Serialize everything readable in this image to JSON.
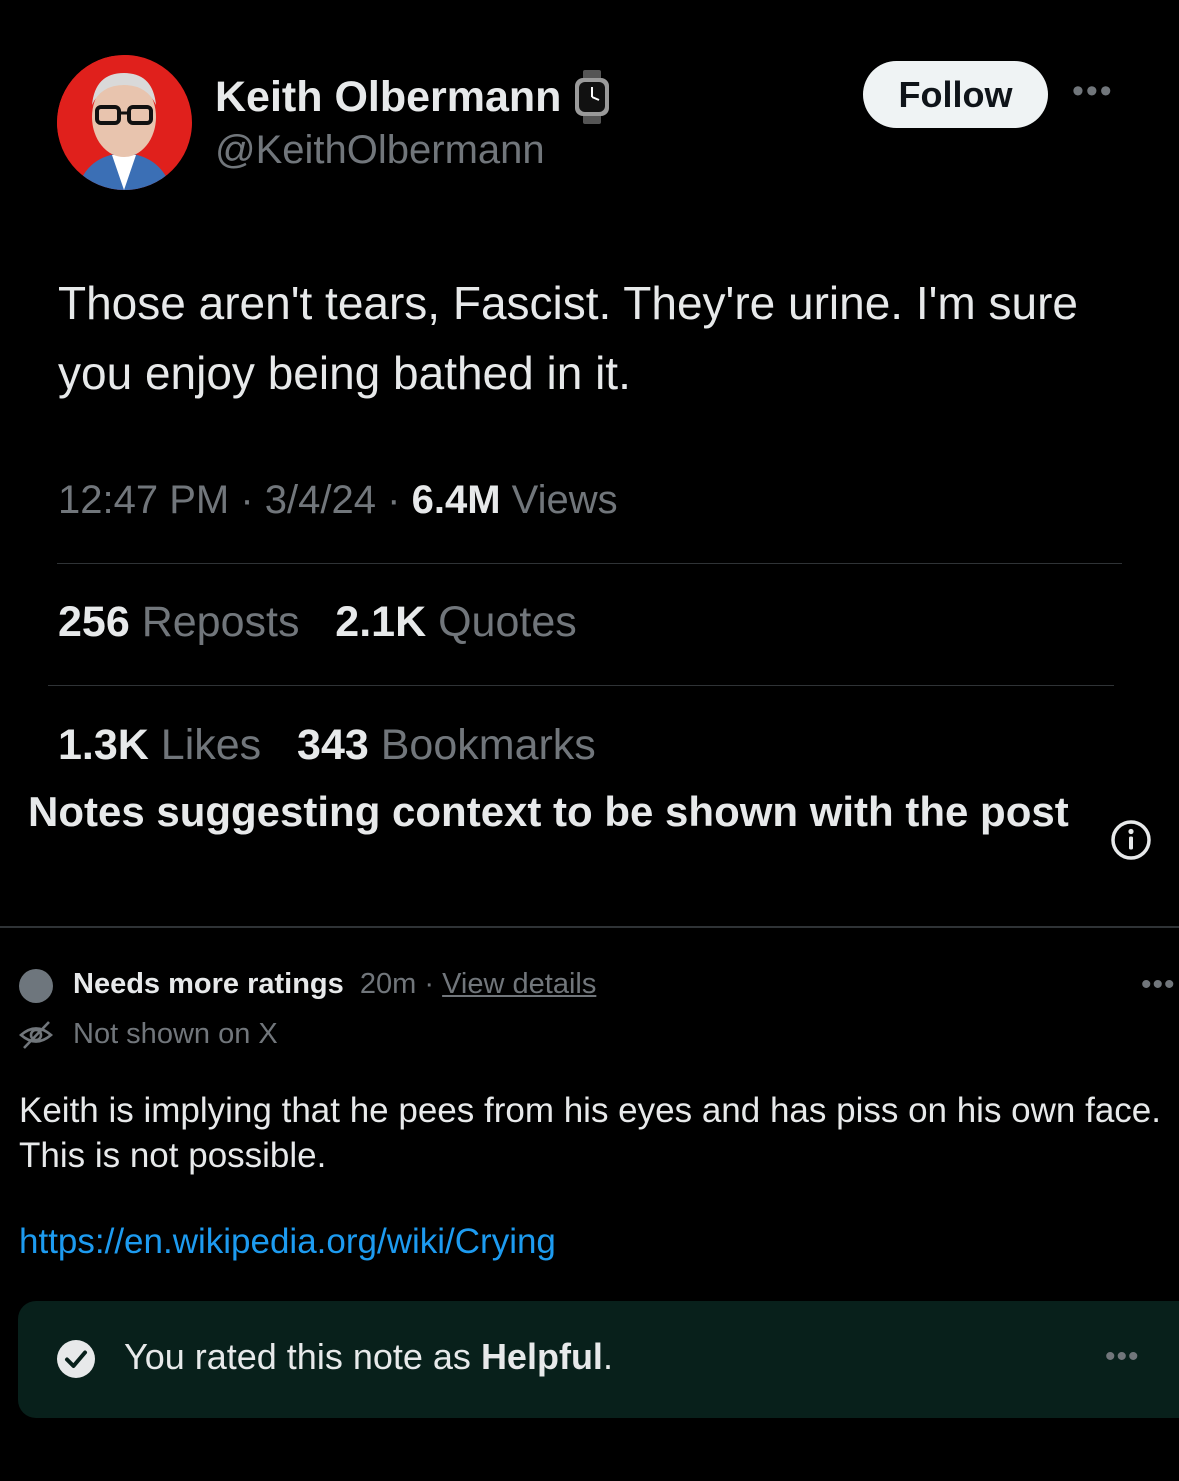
{
  "author": {
    "name": "Keith Olbermann",
    "handle": "@KeithOlbermann",
    "badge_icon": "watch-icon"
  },
  "follow_label": "Follow",
  "more_icon": "more-horizontal-icon",
  "tweet": {
    "text": "Those aren't tears, Fascist. They're urine. I'm sure you enjoy being bathed in it.",
    "time": "12:47 PM",
    "date": "3/4/24",
    "views_count": "6.4M",
    "views_label": "Views",
    "separator": "·"
  },
  "stats": {
    "reposts_count": "256",
    "reposts_label": "Reposts",
    "quotes_count": "2.1K",
    "quotes_label": "Quotes",
    "likes_count": "1.3K",
    "likes_label": "Likes",
    "bookmarks_count": "343",
    "bookmarks_label": "Bookmarks"
  },
  "notes": {
    "title": "Notes suggesting context to be shown with the post",
    "info_icon": "info-icon"
  },
  "note": {
    "status": "Needs more ratings",
    "age": "20m",
    "separator": "·",
    "details_link": "View details",
    "visibility": "Not shown on X",
    "text": "Keith is implying that he pees from his eyes and has piss on his own face. This is not possible.",
    "link": "https://en.wikipedia.org/wiki/Crying"
  },
  "rating": {
    "prefix": "You rated this note as",
    "value": "Helpful",
    "suffix": "."
  },
  "colors": {
    "background": "#000000",
    "text": "#e7e9ea",
    "muted": "#71767b",
    "link": "#1d9bf0",
    "rated_box": "#08201b",
    "avatar_bg": "#e0201c"
  }
}
